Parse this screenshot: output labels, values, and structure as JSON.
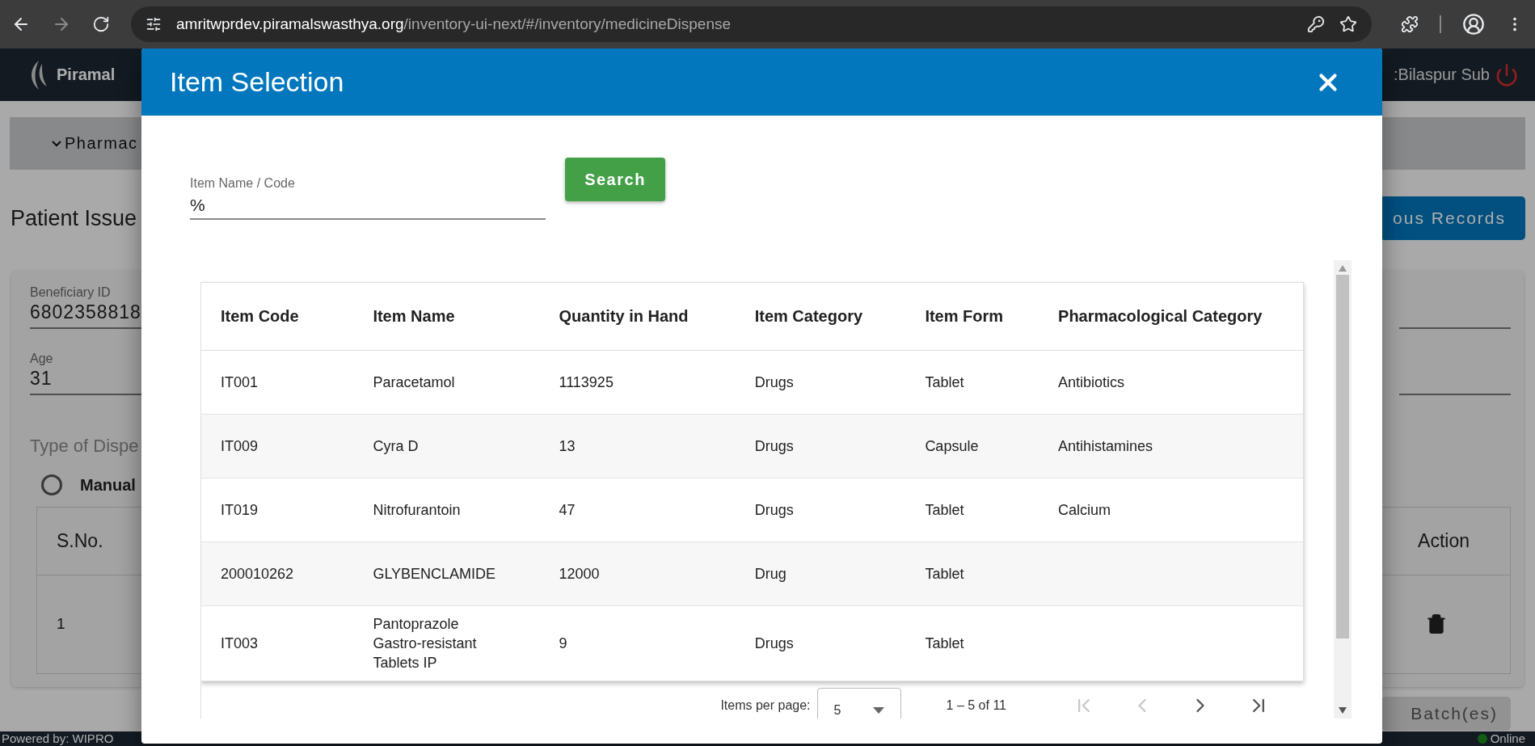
{
  "browser": {
    "url_host": "amritwprdev.piramalswasthya.org",
    "url_path": "/inventory-ui-next/#/inventory/medicineDispense"
  },
  "header": {
    "brand": "Piramal",
    "location": ":Bilaspur Sub"
  },
  "page": {
    "section_toggle": "Pharmac",
    "title": "Patient Issue",
    "records_button": "ous Records",
    "fields": [
      {
        "label": "Beneficiary ID",
        "value": "6802358818"
      },
      {
        "label": "Age",
        "value": "31"
      }
    ],
    "dispense_type_label": "Type of Dispe",
    "dispense_options": [
      {
        "label": "Manual",
        "selected": false
      }
    ],
    "table": {
      "columns": [
        "S.No.",
        "Action"
      ],
      "rows": [
        {
          "s_no": "1"
        }
      ]
    },
    "batch_button": "Batch(es)"
  },
  "footer": {
    "powered_by": "Powered by: WIPRO",
    "status": "Online"
  },
  "modal": {
    "title": "Item Selection",
    "search_field": {
      "label": "Item Name / Code",
      "value": "%"
    },
    "search_button": "Search",
    "table": {
      "columns": [
        "Item Code",
        "Item Name",
        "Quantity in Hand",
        "Item Category",
        "Item Form",
        "Pharmacological Category"
      ],
      "rows": [
        [
          "IT001",
          "Paracetamol",
          "1113925",
          "Drugs",
          "Tablet",
          "Antibiotics"
        ],
        [
          "IT009",
          "Cyra D",
          "13",
          "Drugs",
          "Capsule",
          "Antihistamines"
        ],
        [
          "IT019",
          "Nitrofurantoin",
          "47",
          "Drugs",
          "Tablet",
          "Calcium"
        ],
        [
          "200010262",
          "GLYBENCLAMIDE",
          "12000",
          "Drug",
          "Tablet",
          ""
        ],
        [
          "IT003",
          "Pantoprazole Gastro-resistant Tablets IP",
          "9",
          "Drugs",
          "Tablet",
          ""
        ]
      ]
    },
    "paginator": {
      "items_per_page_label": "Items per page:",
      "page_size": "5",
      "range": "1 – 5 of 11",
      "nav": [
        {
          "kind": "first",
          "disabled": true
        },
        {
          "kind": "previous",
          "disabled": true
        },
        {
          "kind": "next",
          "disabled": false
        },
        {
          "kind": "last",
          "disabled": false
        }
      ]
    }
  }
}
